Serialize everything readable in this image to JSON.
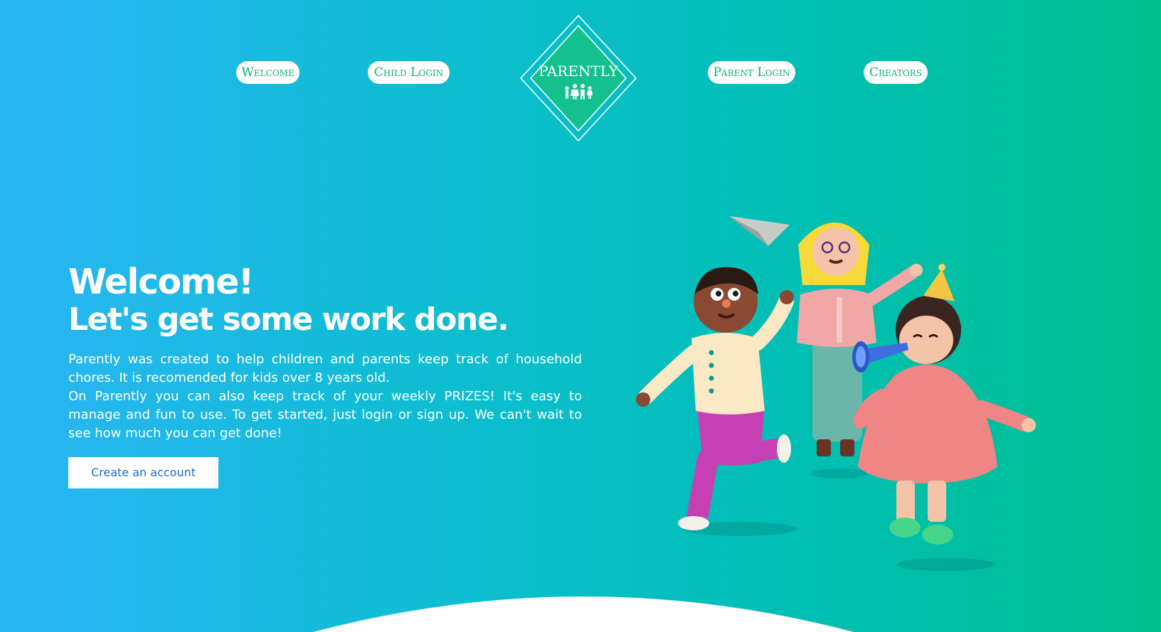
{
  "nav": {
    "items": [
      {
        "label": "Welcome"
      },
      {
        "label": "Child Login"
      },
      {
        "label": "Parent Login"
      },
      {
        "label": "Creators"
      }
    ]
  },
  "logo": {
    "text": "PARENTLY",
    "icon": "family-icon"
  },
  "hero": {
    "title_line1": "Welcome!",
    "title_line2": "Let's get some work done.",
    "paragraph1": "Parently was created to help children and parents keep track of household chores. It is recomended for kids over 8 years old.",
    "paragraph2": "On Parently you can also keep track of your weekly PRIZES! It's easy to manage and fun to use. To get started, just login or sign up. We can't wait to see how much you can get done!",
    "cta_label": "Create an account"
  },
  "colors": {
    "gradient_start": "#2bb5f4",
    "gradient_end": "#00bf8c",
    "logo_fill": "#13c08e",
    "cta_text": "#1a6bd6",
    "nav_text": "#0bb37e"
  }
}
